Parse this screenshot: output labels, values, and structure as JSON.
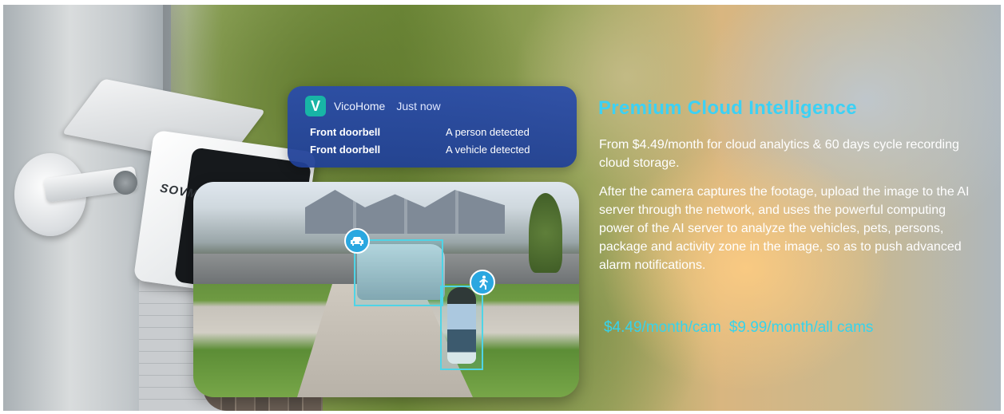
{
  "notification": {
    "app_name": "VicoHome",
    "app_logo_letter": "V",
    "time": "Just now",
    "rows": [
      {
        "source": "Front doorbell",
        "message": "A person detected"
      },
      {
        "source": "Front doorbell",
        "message": "A vehicle detected"
      }
    ]
  },
  "camera": {
    "brand": "SOVMIKU"
  },
  "content": {
    "title": "Premium Cloud Intelligence",
    "paragraph1": "From $4.49/month for cloud analytics & 60 days cycle recording cloud storage.",
    "paragraph2": "After the camera captures the footage, upload the image to the AI server through the network, and uses the powerful computing power of the AI server to analyze the vehicles, pets,  persons, package and activity zone in the image, so as to push advanced alarm notifications.",
    "price_single": "$4.49/month/cam",
    "price_all": "$9.99/month/all cams"
  },
  "colors": {
    "accent": "#3cd1f5",
    "notification_bg": "#2a4caa",
    "detection_box": "#4fd4e6"
  },
  "icons": {
    "vehicle": "car-icon",
    "person": "running-person-icon"
  }
}
